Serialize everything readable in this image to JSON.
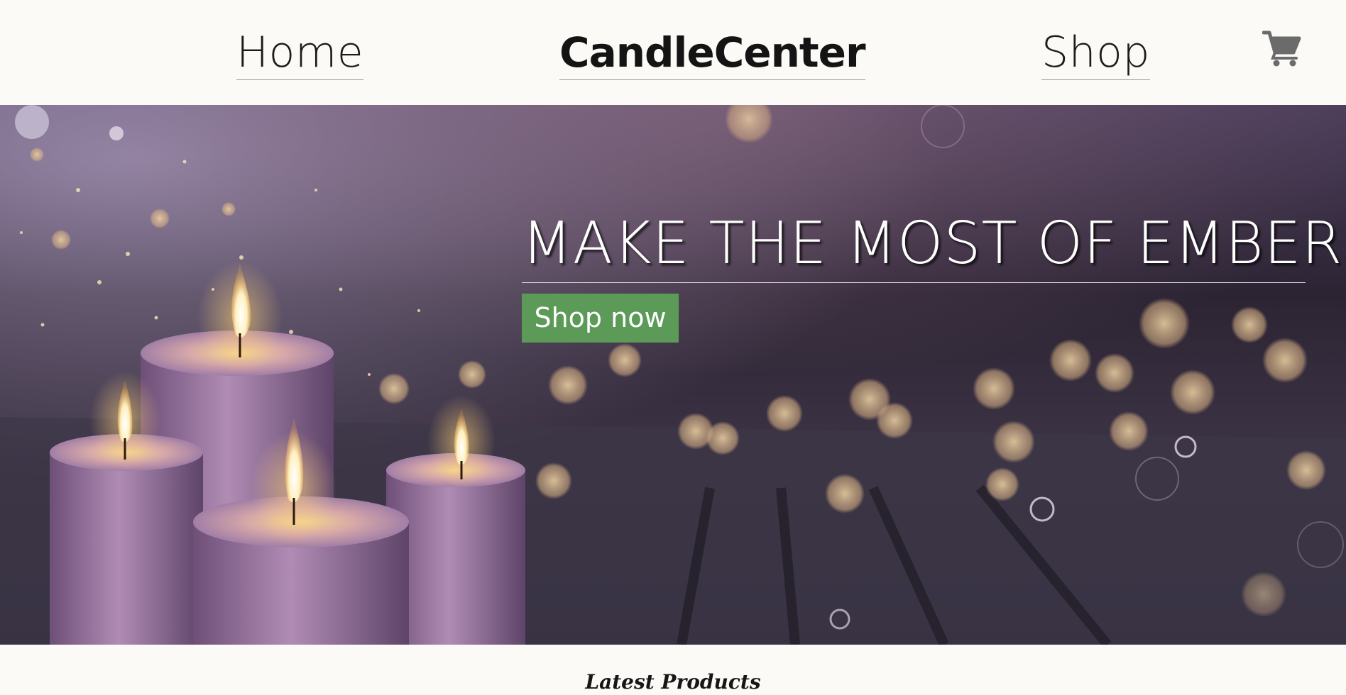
{
  "header": {
    "nav_home": "Home",
    "brand": "CandleCenter",
    "nav_shop": "Shop",
    "cart_icon": "cart-icon"
  },
  "hero": {
    "title": "MAKE THE MOST OF EMBER",
    "cta_label": "Shop now",
    "cta_color": "#5b9a57",
    "image": "candles-with-bokeh-image"
  },
  "section": {
    "title": "Latest Products"
  },
  "colors": {
    "page_background": "#fbfaf6",
    "text": "#1b1b1b"
  }
}
